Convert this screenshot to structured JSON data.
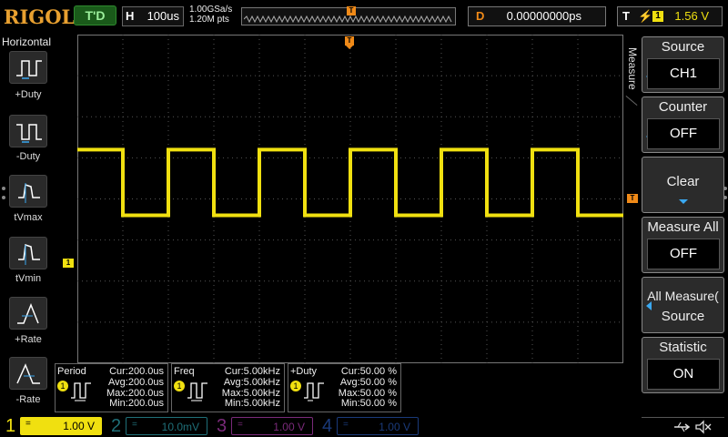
{
  "topbar": {
    "brand": "RIGOL",
    "run_state": "T'D",
    "horizontal_label": "H",
    "timebase": "100us",
    "sample_rate": "1.00GSa/s",
    "memory_depth": "1.20M pts",
    "trigger_marker": "T",
    "delay_label": "D",
    "delay_value": "0.00000000ps",
    "trigger_label": "T",
    "trigger_edge_icon": "rising-edge-icon",
    "trigger_source": "1",
    "trigger_level": "1.56 V"
  },
  "leftbar": {
    "title": "Horizontal",
    "items": [
      {
        "label": "+Duty",
        "icon": "positive-duty-icon"
      },
      {
        "label": "-Duty",
        "icon": "negative-duty-icon"
      },
      {
        "label": "tVmax",
        "icon": "time-at-vmax-icon"
      },
      {
        "label": "tVmin",
        "icon": "time-at-vmin-icon"
      },
      {
        "label": "+Rate",
        "icon": "rise-rate-icon"
      },
      {
        "label": "-Rate",
        "icon": "fall-rate-icon"
      }
    ]
  },
  "waveform": {
    "channel_marker": "1",
    "trigger_level_marker": "T",
    "color": "#f0e010",
    "period_divs": 2,
    "high_level": 1.2,
    "low_level": -0.4
  },
  "measurements": [
    {
      "name": "Period",
      "channel": "1",
      "cur": "Cur:200.0us",
      "avg": "Avg:200.0us",
      "max": "Max:200.0us",
      "min": "Min:200.0us"
    },
    {
      "name": "Freq",
      "channel": "1",
      "cur": "Cur:5.00kHz",
      "avg": "Avg:5.00kHz",
      "max": "Max:5.00kHz",
      "min": "Min:5.00kHz"
    },
    {
      "name": "+Duty",
      "channel": "1",
      "cur": "Cur:50.00 %",
      "avg": "Avg:50.00 %",
      "max": "Max:50.00 %",
      "min": "Min:50.00 %"
    }
  ],
  "rightmenu": {
    "title": "Measure",
    "source_title": "Source",
    "source_value": "CH1",
    "counter_title": "Counter",
    "counter_value": "OFF",
    "clear_label": "Clear",
    "measure_all_title": "Measure All",
    "measure_all_value": "OFF",
    "all_measure_source_title": "All Measure(",
    "all_measure_source_value": "Source",
    "statistic_title": "Statistic",
    "statistic_value": "ON"
  },
  "channels": [
    {
      "num": "1",
      "coupling": "=",
      "scale": "1.00 V",
      "color": "#f0e010",
      "active": true
    },
    {
      "num": "2",
      "coupling": "=",
      "scale": "10.0mV",
      "color": "#1f6f78",
      "active": false
    },
    {
      "num": "3",
      "coupling": "=",
      "scale": "1.00 V",
      "color": "#7a2a7a",
      "active": false
    },
    {
      "num": "4",
      "coupling": "=",
      "scale": "1.00 V",
      "color": "#1a3a7a",
      "active": false
    }
  ],
  "status_icons": [
    "usb-icon",
    "speaker-muted-icon"
  ],
  "colors": {
    "accent_orange": "#f08a18",
    "ch1_yellow": "#f0e010",
    "menu_blue": "#3aa8f0"
  }
}
